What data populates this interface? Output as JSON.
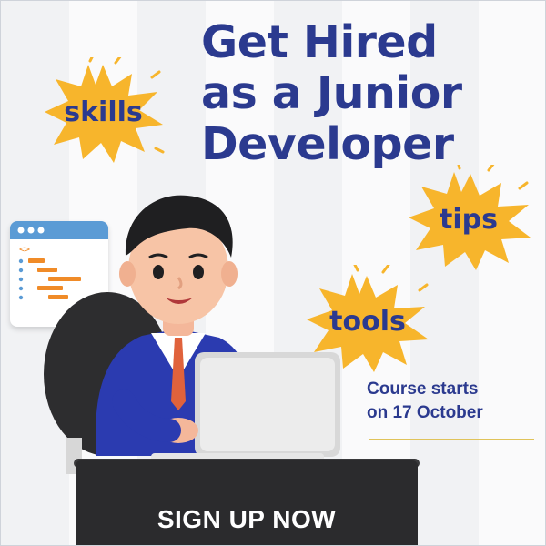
{
  "headline": {
    "line1": "Get Hired",
    "line2": "as a Junior",
    "line3": "Developer"
  },
  "bursts": {
    "skills": "skills",
    "tips": "tips",
    "tools": "tools"
  },
  "course": {
    "line1": "Course starts",
    "line2": "on 17 October"
  },
  "cta": {
    "label": "SIGN UP NOW"
  },
  "colors": {
    "brand_blue": "#2b3a8f",
    "burst_yellow": "#f7b52c",
    "code_orange": "#f08b28"
  }
}
